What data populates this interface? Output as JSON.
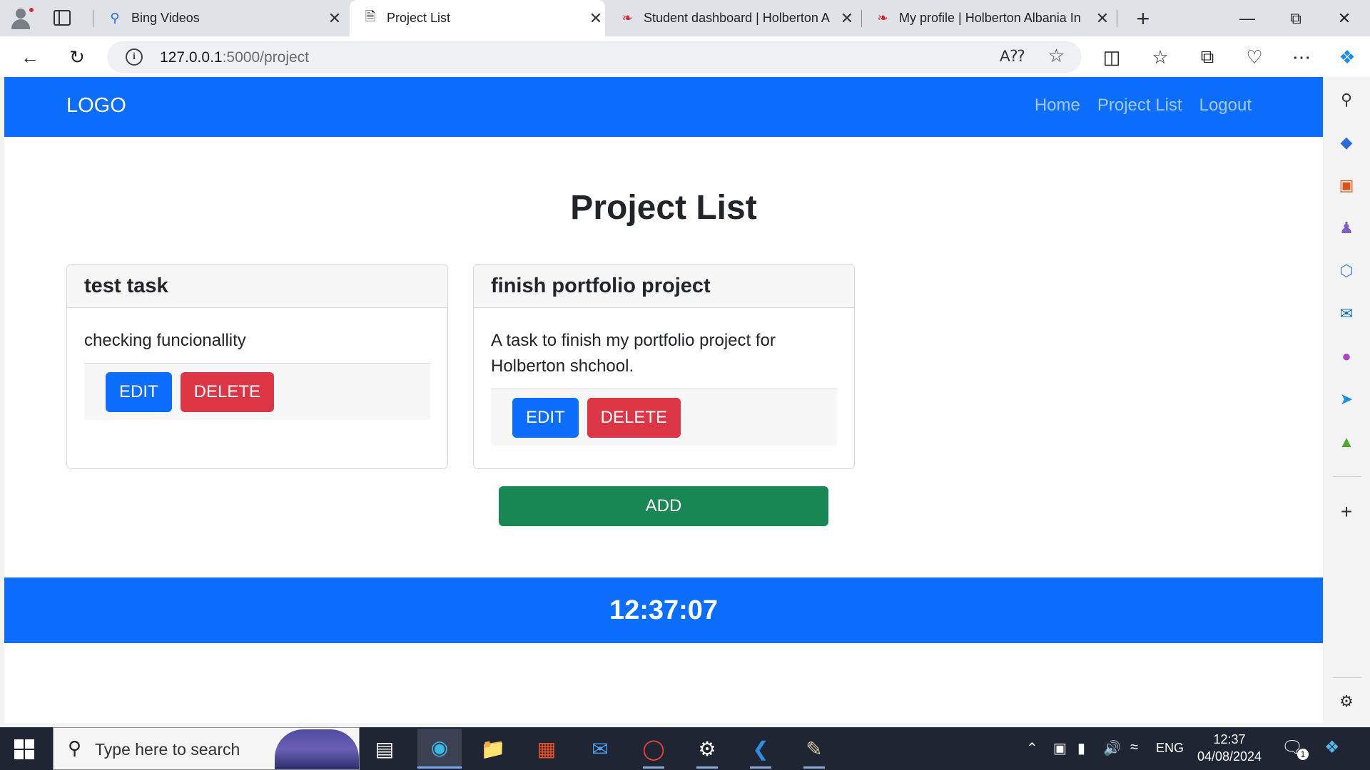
{
  "browser": {
    "tabs": [
      {
        "title": "Bing Videos",
        "favicon": "bing-search-icon",
        "active": false
      },
      {
        "title": "Project List",
        "favicon": "page-icon",
        "active": true
      },
      {
        "title": "Student dashboard | Holberton A",
        "favicon": "holberton-icon",
        "active": false
      },
      {
        "title": "My profile | Holberton Albania In",
        "favicon": "holberton-icon",
        "active": false
      }
    ],
    "url_host": "127.0.0.1",
    "url_path": ":5000/project"
  },
  "navbar": {
    "logo": "LOGO",
    "links": [
      "Home",
      "Project List",
      "Logout"
    ]
  },
  "main": {
    "title": "Project List",
    "projects": [
      {
        "name": "test task",
        "description": "checking funcionallity",
        "edit_label": "EDIT",
        "delete_label": "DELETE"
      },
      {
        "name": "finish portfolio project",
        "description": "A task to finish my portfolio project for Holberton shchool.",
        "edit_label": "EDIT",
        "delete_label": "DELETE"
      }
    ],
    "add_label": "ADD"
  },
  "footer": {
    "clock": "12:37:07"
  },
  "taskbar": {
    "search_placeholder": "Type here to search",
    "language": "ENG",
    "time": "12:37",
    "date": "04/08/2024",
    "notification_count": "1"
  },
  "colors": {
    "primary": "#0d6efd",
    "danger": "#dc3545",
    "success": "#198754"
  }
}
